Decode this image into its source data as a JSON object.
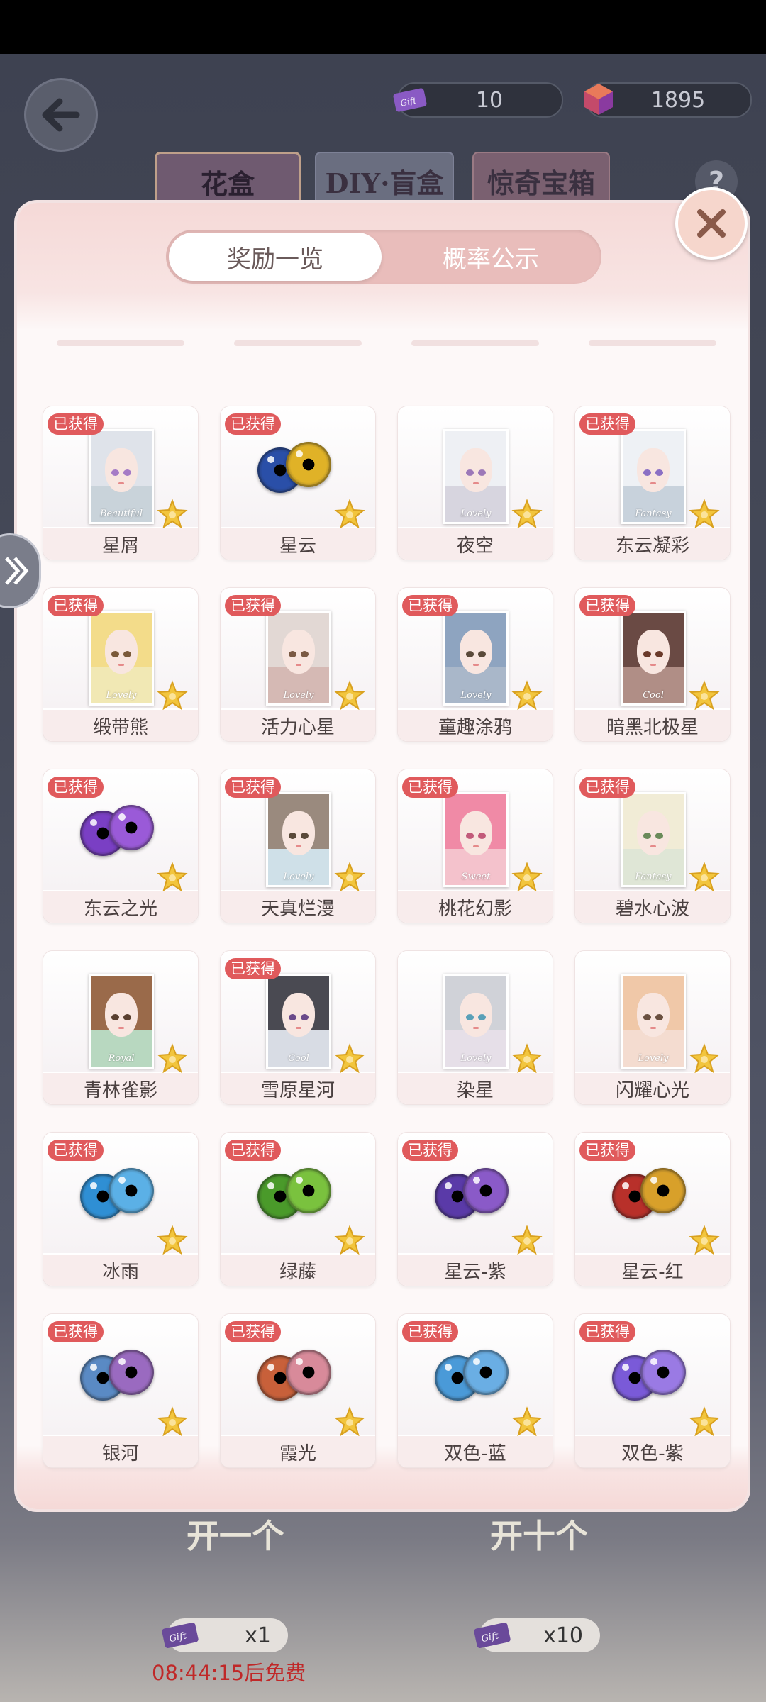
{
  "header": {
    "currencies": [
      {
        "icon": "gift-ticket-icon",
        "value": "10"
      },
      {
        "icon": "gem-cube-icon",
        "value": "1895"
      }
    ],
    "tabs": [
      {
        "label": "花盒"
      },
      {
        "label": "DIY·盲盒"
      },
      {
        "label": "惊奇宝箱"
      }
    ],
    "help_label": "?"
  },
  "modal": {
    "segments": [
      {
        "label": "奖励一览",
        "active": true
      },
      {
        "label": "概率公示",
        "active": false
      }
    ],
    "obtained_badge": "已获得",
    "items": [
      {
        "name": "星屑",
        "type": "portrait",
        "caption": "Beautiful",
        "obtained": true,
        "hair": "#dfe3ea",
        "bg": "#c9d3da",
        "eye": "#a57bc6"
      },
      {
        "name": "星云",
        "type": "eyes",
        "obtained": true,
        "c1": "#2a4fa8",
        "c2": "#e0b227"
      },
      {
        "name": "夜空",
        "type": "portrait",
        "caption": "Lovely",
        "obtained": false,
        "hair": "#eef0f4",
        "bg": "#d7d5df",
        "eye": "#9c78b8"
      },
      {
        "name": "东云凝彩",
        "type": "portrait",
        "caption": "Fantasy",
        "obtained": true,
        "hair": "#eef1f5",
        "bg": "#c8d2dc",
        "eye": "#8a6fc4"
      },
      {
        "name": "缎带熊",
        "type": "portrait",
        "caption": "Lovely",
        "obtained": true,
        "hair": "#f3dc8a",
        "bg": "#f1e8b4",
        "eye": "#7a5a3a"
      },
      {
        "name": "活力心星",
        "type": "portrait",
        "caption": "Lovely",
        "obtained": true,
        "hair": "#e2d8d4",
        "bg": "#d5b9b4",
        "eye": "#7a5a44"
      },
      {
        "name": "童趣涂鸦",
        "type": "portrait",
        "caption": "Lovely",
        "obtained": true,
        "hair": "#8ea4c0",
        "bg": "#a9b7c9",
        "eye": "#5a4a3a"
      },
      {
        "name": "暗黑北极星",
        "type": "portrait",
        "caption": "Cool",
        "obtained": true,
        "hair": "#6a4a44",
        "bg": "#b08e86",
        "eye": "#6a3a2a"
      },
      {
        "name": "东云之光",
        "type": "eyes",
        "obtained": true,
        "c1": "#7a3fc4",
        "c2": "#9a5ad8"
      },
      {
        "name": "天真烂漫",
        "type": "portrait",
        "caption": "Lovely",
        "obtained": true,
        "hair": "#9a8a7e",
        "bg": "#cfe0e8",
        "eye": "#5a4a3a"
      },
      {
        "name": "桃花幻影",
        "type": "portrait",
        "caption": "Sweet",
        "obtained": true,
        "hair": "#f08aa6",
        "bg": "#f4c2cc",
        "eye": "#c25a7a"
      },
      {
        "name": "碧水心波",
        "type": "portrait",
        "caption": "Fantasy",
        "obtained": true,
        "hair": "#f1ecd6",
        "bg": "#dfe6d6",
        "eye": "#6a8a5a"
      },
      {
        "name": "青林雀影",
        "type": "portrait",
        "caption": "Royal",
        "obtained": false,
        "hair": "#9a6a4a",
        "bg": "#b8d8c0",
        "eye": "#5a4030"
      },
      {
        "name": "雪原星河",
        "type": "portrait",
        "caption": "Cool",
        "obtained": true,
        "hair": "#4a4a52",
        "bg": "#d8dce4",
        "eye": "#6a4a8a"
      },
      {
        "name": "染星",
        "type": "portrait",
        "caption": "Lovely",
        "obtained": false,
        "hair": "#d0d2d8",
        "bg": "#e6dfe8",
        "eye": "#5aa0b8"
      },
      {
        "name": "闪耀心光",
        "type": "portrait",
        "caption": "Lovely",
        "obtained": false,
        "hair": "#f0c8a8",
        "bg": "#f4dcd0",
        "eye": "#6a5040"
      },
      {
        "name": "冰雨",
        "type": "eyes",
        "obtained": true,
        "c1": "#2f8fd4",
        "c2": "#5bb0e6"
      },
      {
        "name": "绿藤",
        "type": "eyes",
        "obtained": true,
        "c1": "#4a9a2a",
        "c2": "#7ac23e"
      },
      {
        "name": "星云-紫",
        "type": "eyes",
        "obtained": true,
        "c1": "#5a3aa8",
        "c2": "#8a5ac8"
      },
      {
        "name": "星云-红",
        "type": "eyes",
        "obtained": true,
        "c1": "#b8302a",
        "c2": "#d8a02a"
      },
      {
        "name": "银河",
        "type": "eyes",
        "obtained": true,
        "c1": "#5a8ac4",
        "c2": "#9a6ac0"
      },
      {
        "name": "霞光",
        "type": "eyes",
        "obtained": true,
        "c1": "#c8603a",
        "c2": "#d88a9a"
      },
      {
        "name": "双色-蓝",
        "type": "eyes",
        "obtained": true,
        "c1": "#4a9ad8",
        "c2": "#6aaee4"
      },
      {
        "name": "双色-紫",
        "type": "eyes",
        "obtained": true,
        "c1": "#7a5ad8",
        "c2": "#9a7ae4"
      }
    ]
  },
  "footer": {
    "open_one_label": "开一个",
    "open_ten_label": "开十个",
    "cost_one": "x1",
    "cost_ten": "x10",
    "timer": "08:44:15后免费"
  },
  "colors": {
    "badge": "#e05a5c",
    "segment_active": "#ffffff",
    "segment_track": "#e9bdbb",
    "star": "#f2c53d"
  }
}
